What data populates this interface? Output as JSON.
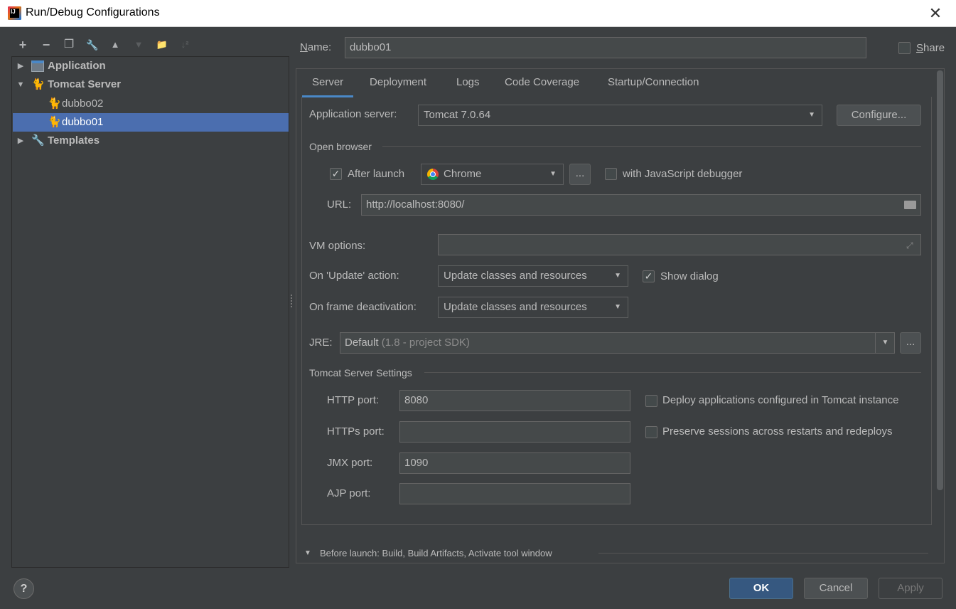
{
  "window": {
    "title": "Run/Debug Configurations",
    "close_glyph": "✕",
    "app_icon_text": "IJ"
  },
  "toolbar": {
    "icons": [
      {
        "name": "add-icon",
        "glyph": "+"
      },
      {
        "name": "remove-icon",
        "glyph": "−"
      },
      {
        "name": "copy-icon",
        "glyph": "❐"
      },
      {
        "name": "wrench-icon",
        "glyph": "🔧"
      },
      {
        "name": "move-up-icon",
        "glyph": "▲"
      },
      {
        "name": "move-down-icon",
        "glyph": "▼"
      },
      {
        "name": "new-folder-icon",
        "glyph": "📁"
      },
      {
        "name": "sort-icon",
        "glyph": "↓²"
      }
    ]
  },
  "tree": {
    "items": [
      {
        "label": "Application",
        "arrow": "▶"
      },
      {
        "label": "Tomcat Server",
        "arrow": "▼"
      },
      {
        "label": "dubbo02"
      },
      {
        "label": "dubbo01"
      },
      {
        "label": "Templates",
        "arrow": "▶"
      }
    ]
  },
  "name_row": {
    "label": "Name:",
    "label_mnemonic": "N",
    "label_rest": "ame:",
    "value": "dubbo01"
  },
  "share": {
    "label": "Share",
    "label_mnemonic": "S",
    "label_rest": "hare",
    "checked": false
  },
  "tabs": [
    "Server",
    "Deployment",
    "Logs",
    "Code Coverage",
    "Startup/Connection"
  ],
  "server": {
    "app_server_label": "Application server:",
    "app_server_value": "Tomcat 7.0.64",
    "configure_label": "Configure...",
    "open_browser_title": "Open browser",
    "after_launch_label": "After launch",
    "after_launch_checked": true,
    "browser_value": "Chrome",
    "ellipsis": "...",
    "js_debugger_label": "with JavaScript debugger",
    "js_debugger_checked": false,
    "url_label": "URL:",
    "url_value": "http://localhost:8080/",
    "vm_options_label": "VM options:",
    "vm_options_value": "",
    "update_action_label": "On 'Update' action:",
    "update_action_value": "Update classes and resources",
    "show_dialog_label": "Show dialog",
    "show_dialog_checked": true,
    "frame_deactivation_label": "On frame deactivation:",
    "frame_deactivation_value": "Update classes and resources",
    "jre_label": "JRE:",
    "jre_value": "Default",
    "jre_hint": "(1.8 - project SDK)",
    "tomcat_settings_title": "Tomcat Server Settings",
    "http_port_label": "HTTP port:",
    "http_port_value": "8080",
    "https_port_label": "HTTPs port:",
    "https_port_value": "",
    "jmx_port_label": "JMX port:",
    "jmx_port_value": "1090",
    "ajp_port_label": "AJP port:",
    "ajp_port_value": "",
    "deploy_configured_label": "Deploy applications configured in Tomcat instance",
    "deploy_configured_checked": false,
    "preserve_sessions_label": "Preserve sessions across restarts and redeploys",
    "preserve_sessions_checked": false
  },
  "before_launch": {
    "label": "Before launch: Build, Build Artifacts, Activate tool window"
  },
  "buttons": {
    "help": "?",
    "ok": "OK",
    "cancel": "Cancel",
    "apply": "Apply"
  },
  "colors": {
    "background": "#3c3f41",
    "selection": "#4b6eaf",
    "tab_underline": "#4a88c7",
    "ok_button": "#365880"
  }
}
